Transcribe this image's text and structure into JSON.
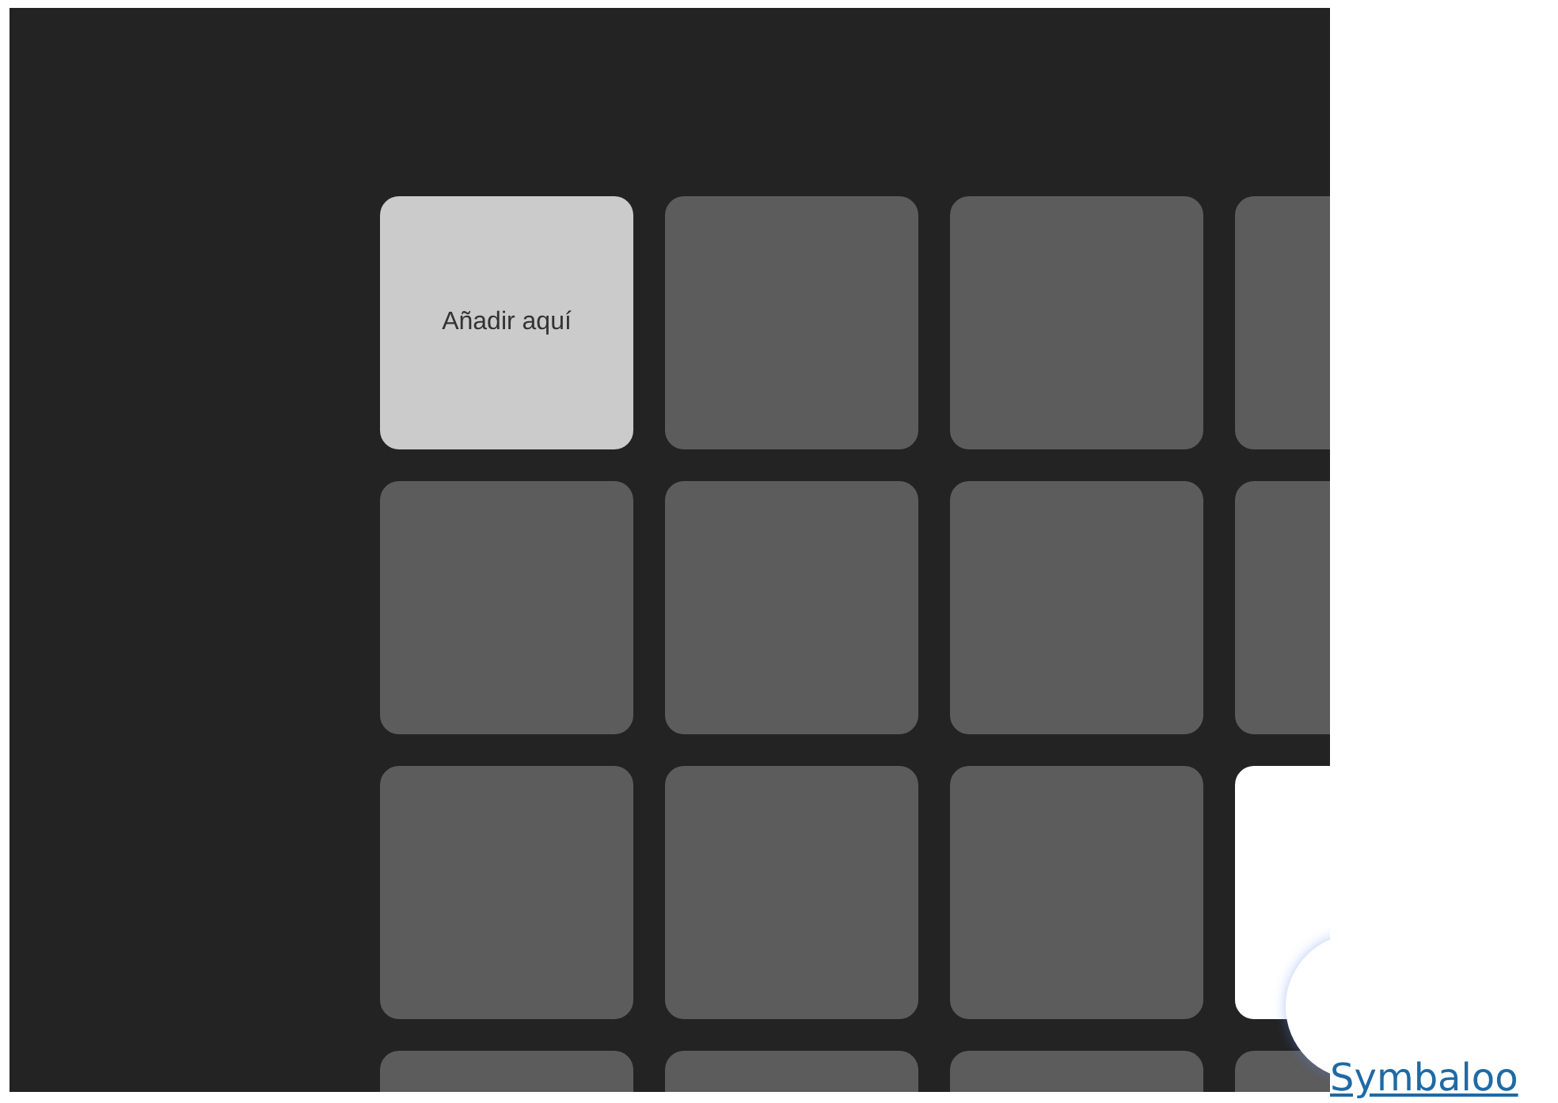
{
  "grid": {
    "tiles": [
      {
        "kind": "add",
        "label": "Añadir aquí"
      },
      {
        "kind": "empty"
      },
      {
        "kind": "empty"
      },
      {
        "kind": "empty"
      },
      {
        "kind": "empty"
      },
      {
        "kind": "empty"
      },
      {
        "kind": "empty"
      },
      {
        "kind": "empty"
      },
      {
        "kind": "empty"
      },
      {
        "kind": "empty"
      },
      {
        "kind": "empty"
      },
      {
        "kind": "white"
      },
      {
        "kind": "empty"
      },
      {
        "kind": "empty"
      },
      {
        "kind": "empty"
      },
      {
        "kind": "empty"
      }
    ]
  },
  "footer_link": "Symbaloo"
}
